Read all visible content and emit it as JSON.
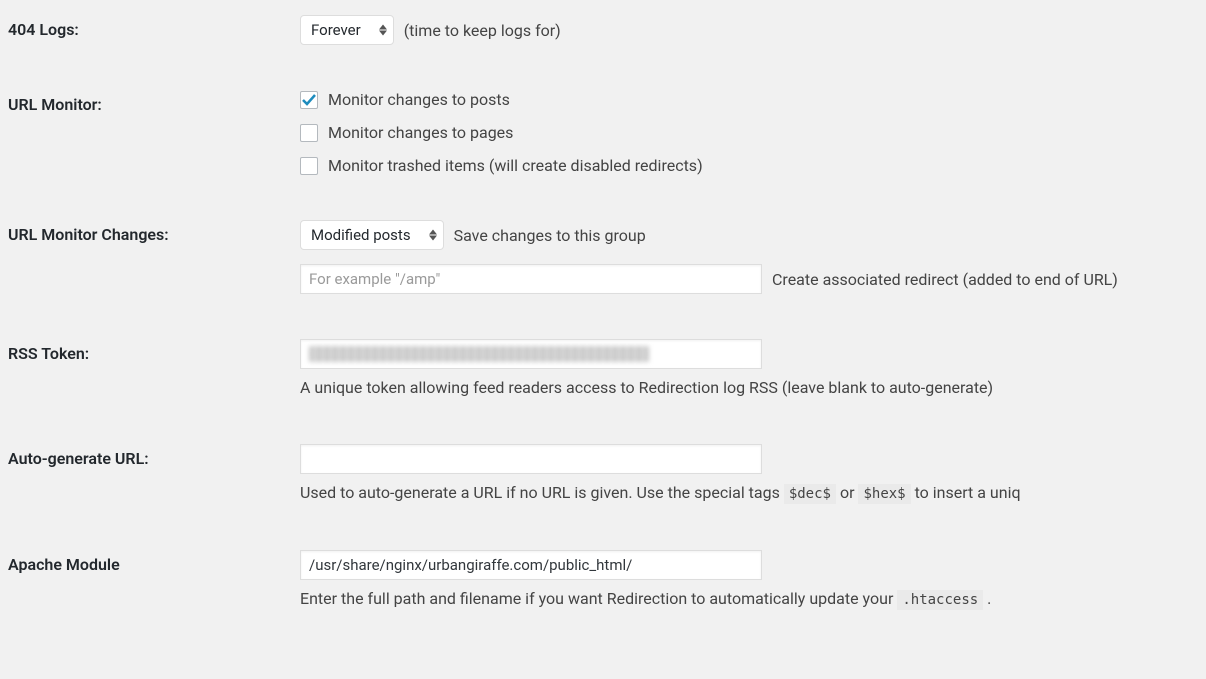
{
  "settings": {
    "logs_404": {
      "label": "404 Logs:",
      "selected": "Forever",
      "desc": "(time to keep logs for)"
    },
    "url_monitor": {
      "label": "URL Monitor:",
      "options": [
        {
          "label": "Monitor changes to posts",
          "checked": true
        },
        {
          "label": "Monitor changes to pages",
          "checked": false
        },
        {
          "label": "Monitor trashed items (will create disabled redirects)",
          "checked": false
        }
      ]
    },
    "url_monitor_changes": {
      "label": "URL Monitor Changes:",
      "selected": "Modified posts",
      "desc": "Save changes to this group",
      "placeholder": "For example \"/amp\"",
      "input_desc": "Create associated redirect (added to end of URL)"
    },
    "rss_token": {
      "label": "RSS Token:",
      "value": "",
      "desc": "A unique token allowing feed readers access to Redirection log RSS (leave blank to auto-generate)"
    },
    "auto_generate": {
      "label": "Auto-generate URL:",
      "value": "",
      "desc_pre": "Used to auto-generate a URL if no URL is given. Use the special tags ",
      "tag1": "$dec$",
      "desc_mid": " or ",
      "tag2": "$hex$",
      "desc_post": " to insert a uniq"
    },
    "apache": {
      "label": "Apache Module",
      "value": "/usr/share/nginx/urbangiraffe.com/public_html/",
      "desc_pre": "Enter the full path and filename if you want Redirection to automatically update your ",
      "file": ".htaccess",
      "desc_post": " ."
    }
  }
}
